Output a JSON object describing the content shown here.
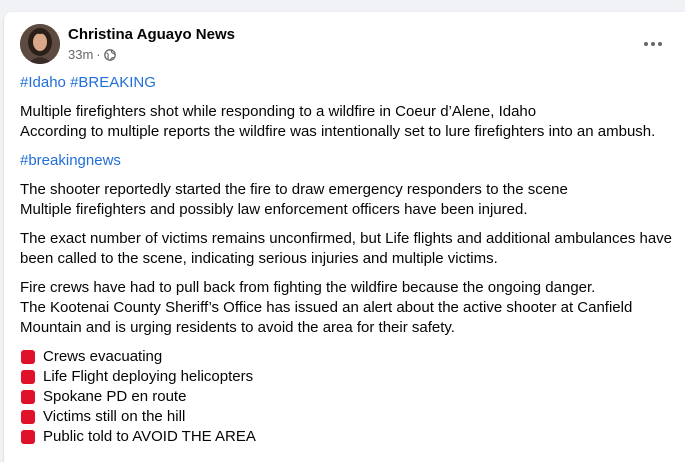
{
  "post": {
    "author": "Christina Aguayo News",
    "time": "33m",
    "separator": "·",
    "privacy_icon": "globe-icon",
    "more_icon": "more-options-icon",
    "hashtags_top": [
      "#Idaho",
      "#BREAKING"
    ],
    "para1": [
      "Multiple firefighters shot while responding to a wildfire in Coeur d’Alene, Idaho",
      "According to multiple reports the wildfire was intentionally set to lure firefighters into an ambush."
    ],
    "hashtag_mid": "#breakingnews",
    "para2": [
      "The shooter reportedly started the fire to draw emergency responders to the scene",
      "Multiple firefighters and possibly law enforcement officers have been injured."
    ],
    "para3": "The exact number of victims remains unconfirmed, but Life flights and additional ambulances have been called to the scene, indicating serious injuries and multiple victims.",
    "para4": [
      "Fire crews have had to pull back from fighting  the wildfire because the ongoing danger.",
      "The Kootenai County Sheriff’s Office has issued an alert about the active shooter at Canfield Mountain and is urging residents to avoid the area for their safety."
    ],
    "bullets": [
      "Crews evacuating",
      "Life Flight deploying helicopters",
      "Spokane PD en route",
      "Victims still on the hill",
      "Public told to AVOID THE AREA"
    ],
    "bullet_icon": "red-square-icon"
  },
  "colors": {
    "link": "#216fdb",
    "bullet": "#e0112b",
    "meta": "#65676b"
  }
}
